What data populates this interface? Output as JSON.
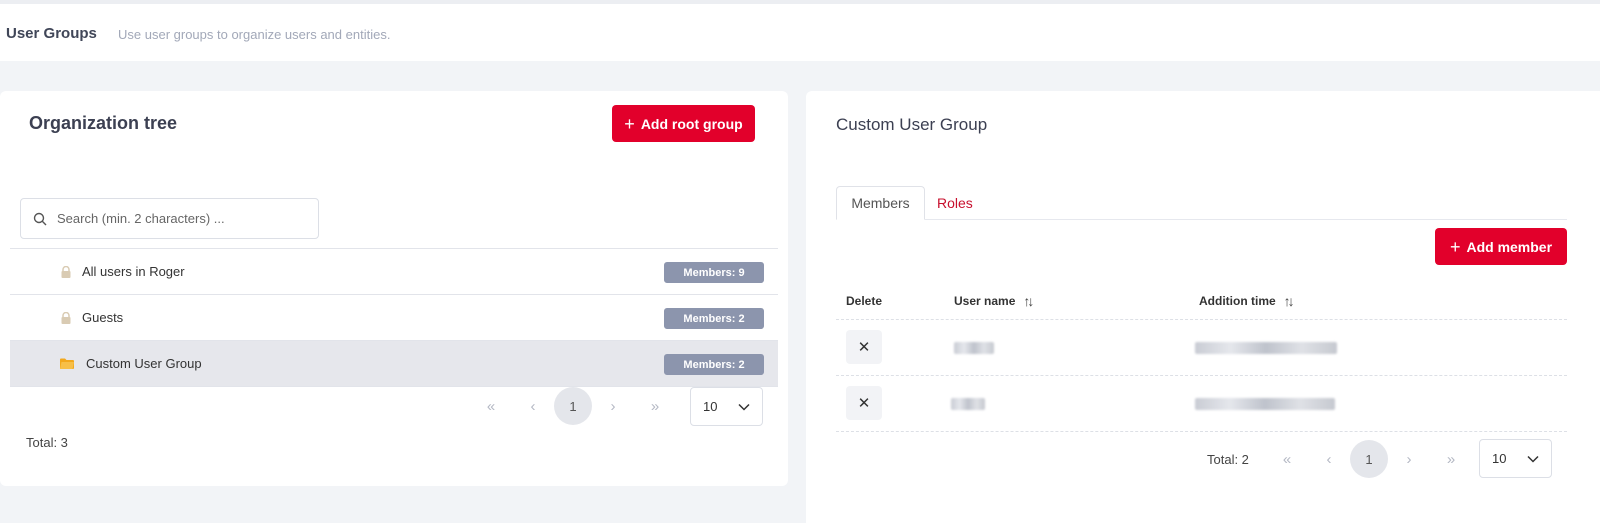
{
  "header": {
    "title": "User Groups",
    "subtitle": "Use user groups to organize users and entities."
  },
  "org_tree": {
    "title": "Organization tree",
    "add_button": "Add root group",
    "search_placeholder": "Search (min. 2 characters) ...",
    "rows": [
      {
        "label": "All users in Roger",
        "badge": "Members: 9",
        "icon": "lock-icon",
        "selected": false
      },
      {
        "label": "Guests",
        "badge": "Members: 2",
        "icon": "lock-icon",
        "selected": false
      },
      {
        "label": "Custom User Group",
        "badge": "Members: 2",
        "icon": "folder-icon",
        "selected": true
      }
    ],
    "pager": {
      "first": "«",
      "prev": "‹",
      "page": "1",
      "next": "›",
      "last": "»"
    },
    "page_size": "10",
    "total": "Total: 3"
  },
  "group_detail": {
    "title": "Custom User Group",
    "tabs": [
      "Members",
      "Roles"
    ],
    "add_button": "Add member",
    "columns": {
      "delete": "Delete",
      "username": "User name",
      "added": "Addition time"
    },
    "sort_glyph": "↑↓",
    "delete_glyph": "✕",
    "members": [
      {
        "username": "████",
        "added": "██████████ █████████"
      },
      {
        "username": "████",
        "added": "█████████ ███████"
      }
    ],
    "total": "Total: 2",
    "pager": {
      "first": "«",
      "prev": "‹",
      "page": "1",
      "next": "›",
      "last": "»"
    },
    "page_size": "10"
  },
  "colors": {
    "accent": "#e2002b",
    "badge": "#8c95ad",
    "lock": "#d9cbb3",
    "folder": "#f2a81d"
  }
}
